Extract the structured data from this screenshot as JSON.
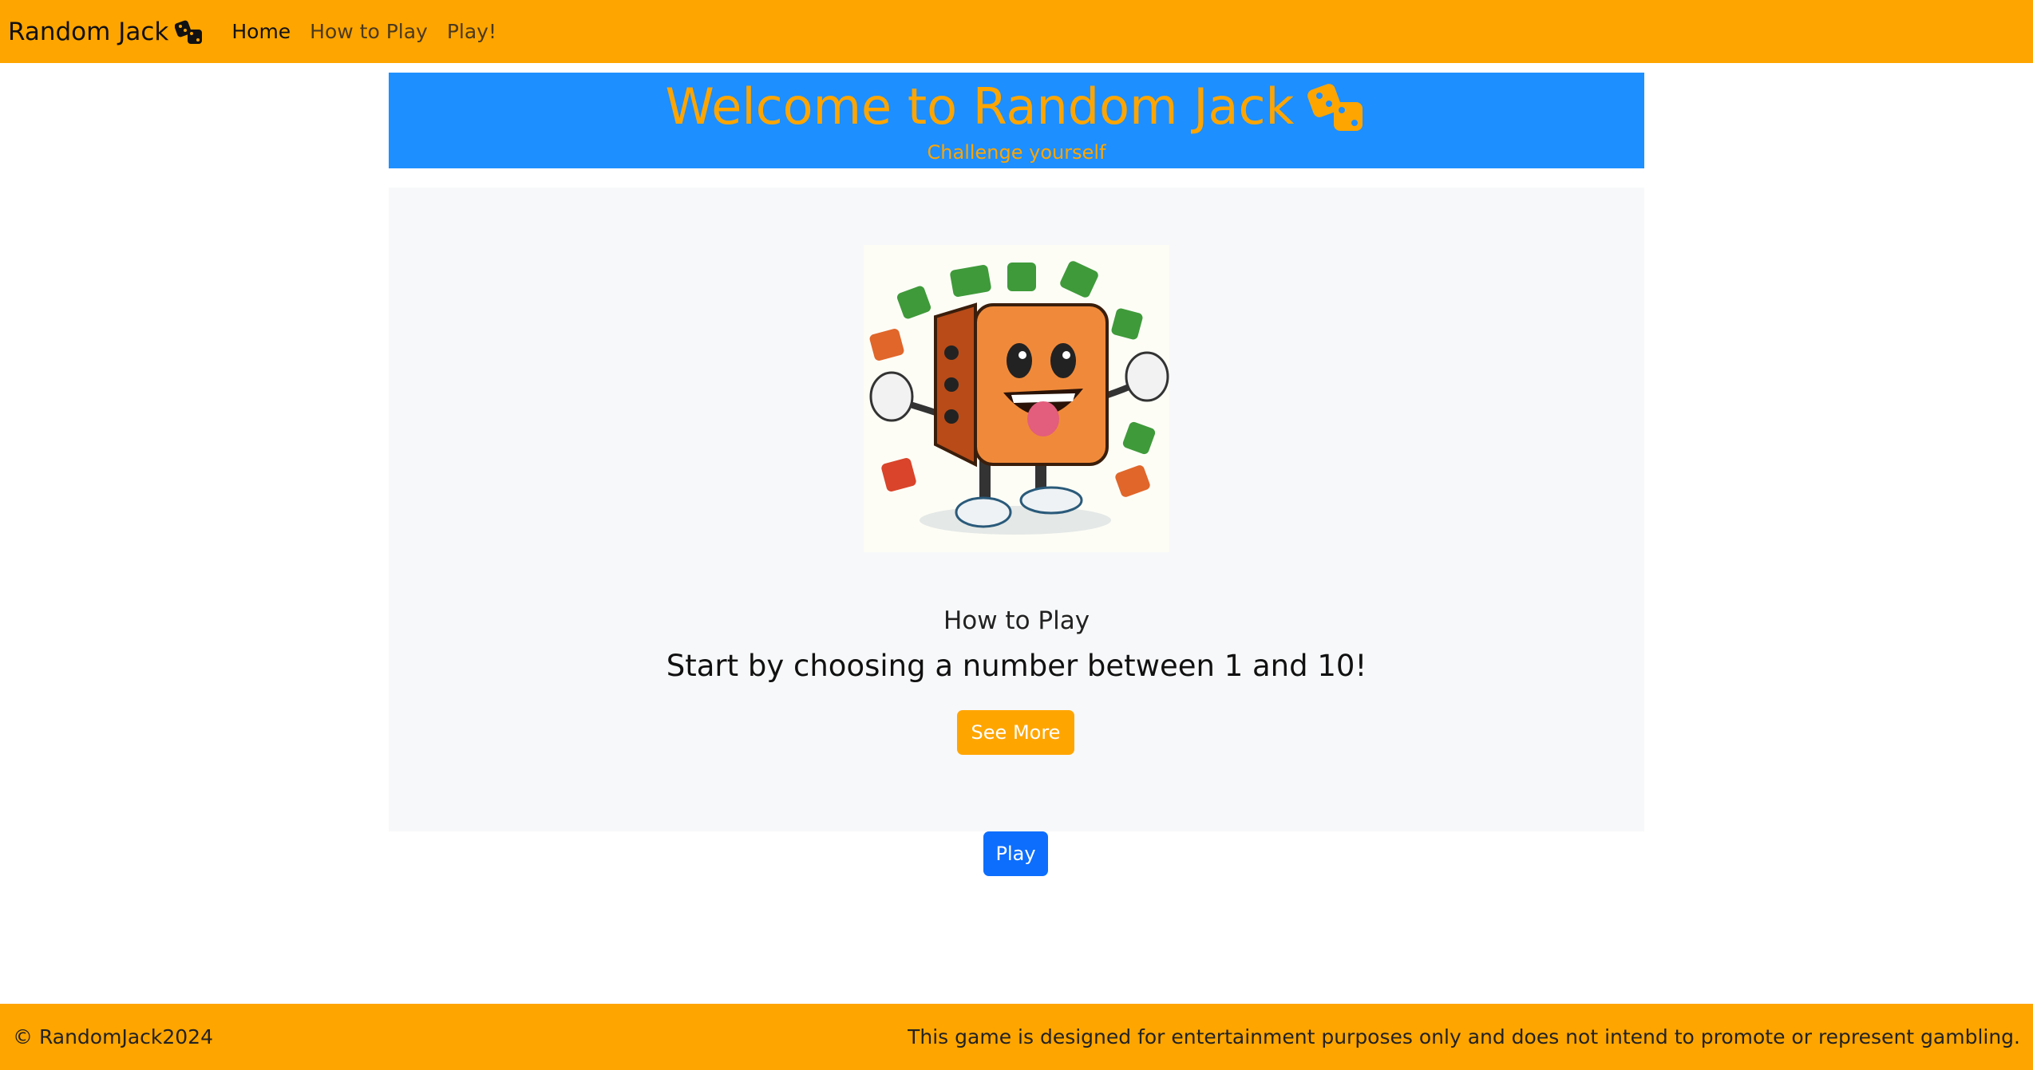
{
  "navbar": {
    "brand": "Random Jack",
    "brand_icon": "dice-icon",
    "links": [
      {
        "label": "Home",
        "active": true
      },
      {
        "label": "How to Play",
        "active": false
      },
      {
        "label": "Play!",
        "active": false
      }
    ]
  },
  "banner": {
    "title": "Welcome to Random Jack",
    "subtitle": "Challenge yourself",
    "icon": "dice-icon"
  },
  "card": {
    "image": "dice-mascot-illustration",
    "heading": "How to Play",
    "text": "Start by choosing a number between 1 and 10!",
    "button": "See More"
  },
  "play_button": "Play",
  "footer": {
    "copyright": "© RandomJack2024",
    "disclaimer": "This game is designed for entertainment purposes only and does not intend to promote or represent gambling."
  },
  "colors": {
    "navbar": "#ffa500",
    "banner": "#1e8fff",
    "accent": "#ffa500",
    "primary": "#0d6efd"
  }
}
